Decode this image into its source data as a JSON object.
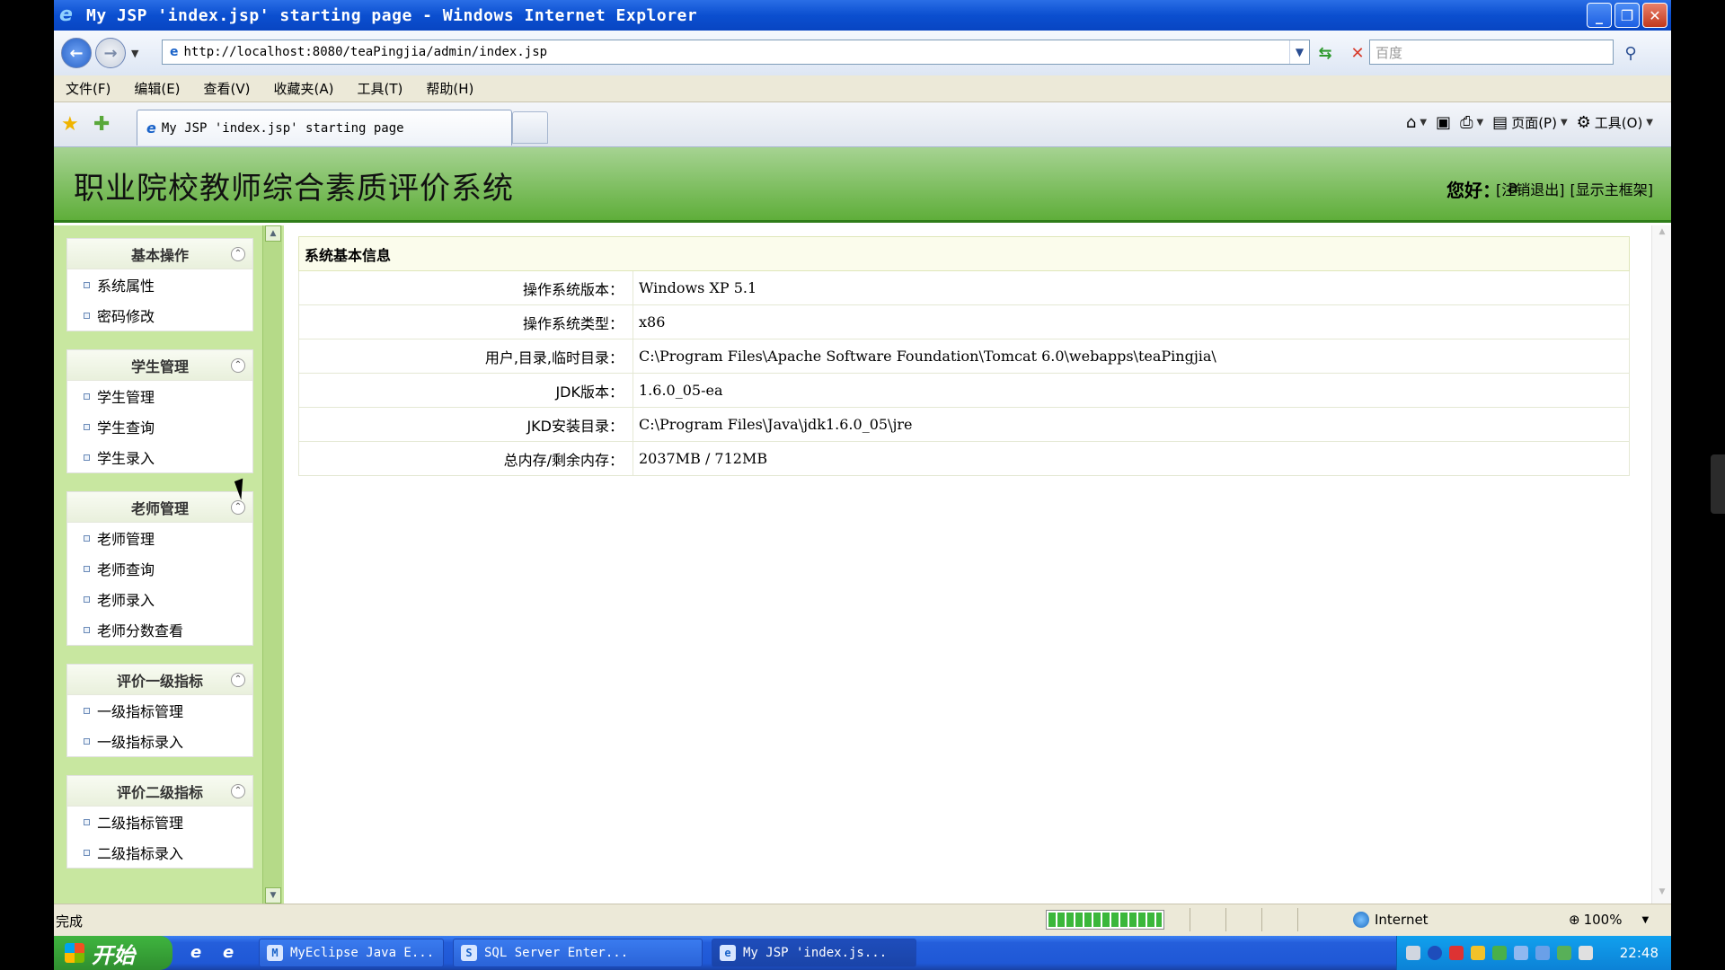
{
  "window": {
    "title": "My JSP 'index.jsp' starting page - Windows Internet Explorer",
    "minimize": "_",
    "restore": "❐",
    "close": "✕"
  },
  "address_bar": {
    "url": "http://localhost:8080/teaPingjia/admin/index.jsp",
    "search_placeholder": "百度"
  },
  "menu": [
    "文件(F)",
    "编辑(E)",
    "查看(V)",
    "收藏夹(A)",
    "工具(T)",
    "帮助(H)"
  ],
  "tab": {
    "label": "My JSP 'index.jsp' starting page"
  },
  "commands": {
    "page": "页面(P)",
    "tools": "工具(O)"
  },
  "header": {
    "title": "职业院校教师综合素质评价系统",
    "greeting": "您好：",
    "user": "a",
    "logout": "[注销退出]",
    "show_frame": "[显示主框架]"
  },
  "sidebar": {
    "groups": [
      {
        "title": "基本操作",
        "items": [
          "系统属性",
          "密码修改"
        ]
      },
      {
        "title": "学生管理",
        "items": [
          "学生管理",
          "学生查询",
          "学生录入"
        ]
      },
      {
        "title": "老师管理",
        "items": [
          "老师管理",
          "老师查询",
          "老师录入",
          "老师分数查看"
        ]
      },
      {
        "title": "评价一级指标",
        "items": [
          "一级指标管理",
          "一级指标录入"
        ]
      },
      {
        "title": "评价二级指标",
        "items": [
          "二级指标管理",
          "二级指标录入"
        ]
      }
    ]
  },
  "info": {
    "heading": "系统基本信息",
    "rows": [
      {
        "label": "操作系统版本：",
        "value": "Windows XP  5.1"
      },
      {
        "label": "操作系统类型：",
        "value": "x86"
      },
      {
        "label": "用户,目录,临时目录：",
        "value": "C:\\Program Files\\Apache Software Foundation\\Tomcat 6.0\\webapps\\teaPingjia\\"
      },
      {
        "label": "JDK版本：",
        "value": "1.6.0_05-ea"
      },
      {
        "label": "JKD安装目录：",
        "value": "C:\\Program Files\\Java\\jdk1.6.0_05\\jre"
      },
      {
        "label": "总内存/剩余内存：",
        "value": "2037MB  /  712MB"
      }
    ]
  },
  "status": {
    "text": "完成",
    "zone": "Internet",
    "zoom": "100%"
  },
  "taskbar": {
    "start": "开始",
    "tasks": [
      "MyEclipse Java E...",
      "SQL Server Enter...",
      "My JSP 'index.js..."
    ],
    "clock": "22:48"
  }
}
